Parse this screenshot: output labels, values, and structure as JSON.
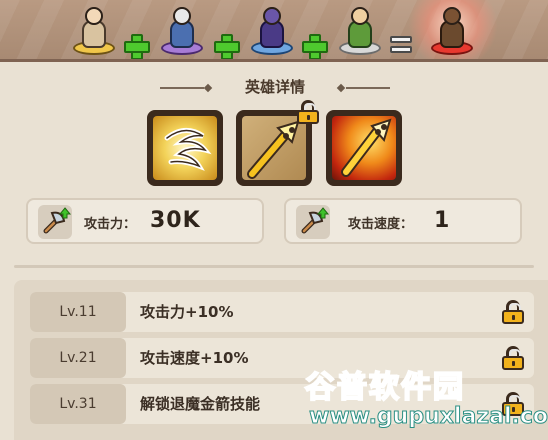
{
  "hero_recipe": {
    "slots": [
      {
        "icon": "tornado-king-hero-icon"
      },
      {
        "icon": "dwarf-gunner-hero-icon"
      },
      {
        "icon": "dark-mage-hero-icon"
      },
      {
        "icon": "elf-archer-hero-icon"
      }
    ],
    "result_icon": "combined-hero-icon"
  },
  "section": {
    "title": "英雄详情"
  },
  "skills": [
    {
      "icon": "whirlwind-slash-icon",
      "locked": false
    },
    {
      "icon": "flaming-arrow-icon",
      "locked": true
    },
    {
      "icon": "fire-arrow-burst-icon",
      "locked": false
    }
  ],
  "stats": {
    "attack": {
      "label": "攻击力：",
      "value": "30K"
    },
    "speed": {
      "label": "攻击速度：",
      "value": "1"
    }
  },
  "upgrades": [
    {
      "level": "Lv.11",
      "desc": "攻击力+10%",
      "locked": true
    },
    {
      "level": "Lv.21",
      "desc": "攻击速度+10%",
      "locked": true
    },
    {
      "level": "Lv.31",
      "desc": "解锁退魔金箭技能",
      "locked": true
    }
  ],
  "watermark": {
    "title": "谷普软件园",
    "url": "www.gupuxlazal.com"
  },
  "colors": {
    "lock_gold": "#f2b21c",
    "plus_green": "#4ec92e",
    "watermark_teal": "#2fb8a8"
  }
}
